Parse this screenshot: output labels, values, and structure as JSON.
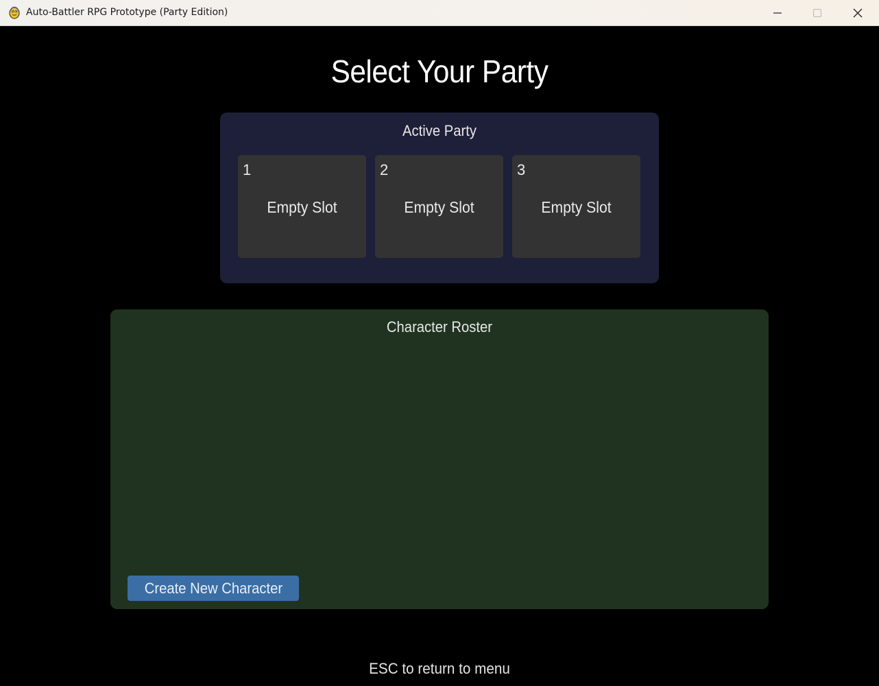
{
  "window": {
    "title": "Auto-Battler RPG Prototype (Party Edition)",
    "icon": "pygame-snake-icon",
    "controls": {
      "minimize": "minimize-icon",
      "maximize": "maximize-icon",
      "close": "close-icon"
    }
  },
  "screen": {
    "title": "Select Your Party"
  },
  "party": {
    "title": "Active Party",
    "slots": [
      {
        "number": "1",
        "label": "Empty Slot"
      },
      {
        "number": "2",
        "label": "Empty Slot"
      },
      {
        "number": "3",
        "label": "Empty Slot"
      }
    ]
  },
  "roster": {
    "title": "Character Roster",
    "create_button": "Create New Character"
  },
  "footer": {
    "hint": "ESC to return to menu"
  },
  "colors": {
    "background": "#000000",
    "party_panel": "#1e1f38",
    "slot": "#333333",
    "roster_panel": "#203320",
    "button": "#3a6ea5"
  }
}
